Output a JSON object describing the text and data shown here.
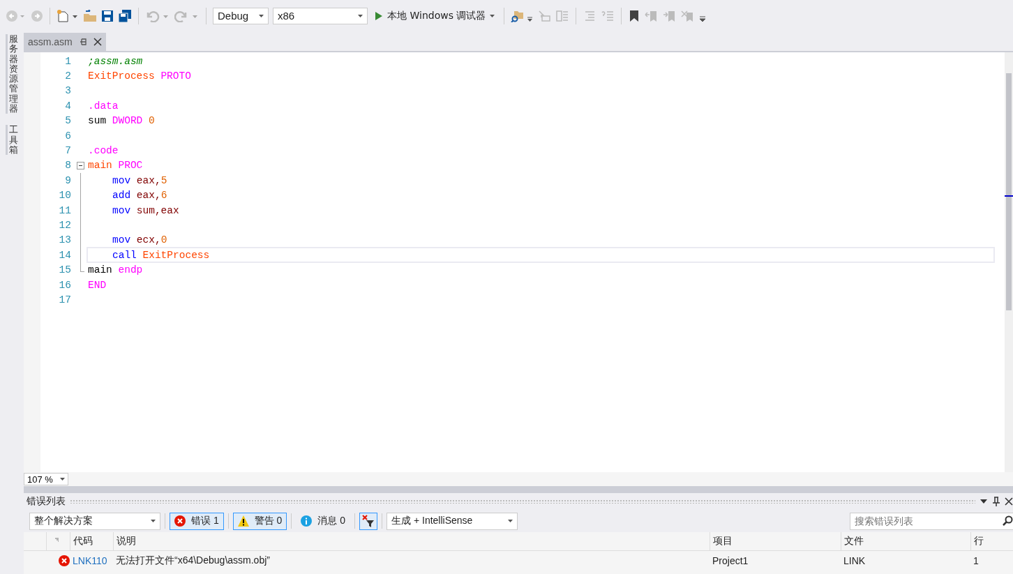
{
  "toolbar": {
    "configuration": "Debug",
    "platform": "x86",
    "run_label": "本地 Windows 调试器"
  },
  "side_tabs": [
    "服务器资源管理器",
    "工具箱"
  ],
  "document_tabs": [
    {
      "label": "assm.asm",
      "selected": true
    }
  ],
  "editor": {
    "lines": [
      {
        "number": "1",
        "tokens": [
          {
            "text": ";assm.asm",
            "kind": "comment"
          }
        ]
      },
      {
        "number": "2",
        "tokens": [
          {
            "text": "ExitProcess ",
            "kind": "proc"
          },
          {
            "text": "PROTO",
            "kind": "directive"
          }
        ]
      },
      {
        "number": "3"
      },
      {
        "number": "4",
        "tokens": [
          {
            "text": ".data",
            "kind": "directive"
          }
        ]
      },
      {
        "number": "5",
        "tokens": [
          {
            "text": "sum ",
            "kind": "plain"
          },
          {
            "text": "DWORD ",
            "kind": "directive"
          },
          {
            "text": "0",
            "kind": "number"
          }
        ]
      },
      {
        "number": "6"
      },
      {
        "number": "7",
        "tokens": [
          {
            "text": ".code",
            "kind": "directive"
          }
        ]
      },
      {
        "number": "8",
        "expanded": true,
        "tokens": [
          {
            "text": "main ",
            "kind": "proc"
          },
          {
            "text": "PROC",
            "kind": "directive"
          }
        ],
        "children": [
          {
            "number": "9",
            "indent": true,
            "tokens": [
              {
                "text": "mov ",
                "kind": "instr"
              },
              {
                "text": "eax,",
                "kind": "register"
              },
              {
                "text": "5",
                "kind": "number"
              }
            ]
          },
          {
            "number": "10",
            "indent": true,
            "tokens": [
              {
                "text": "add ",
                "kind": "instr"
              },
              {
                "text": "eax,",
                "kind": "register"
              },
              {
                "text": "6",
                "kind": "number"
              }
            ]
          },
          {
            "number": "11",
            "indent": true,
            "tokens": [
              {
                "text": "mov ",
                "kind": "instr"
              },
              {
                "text": "sum,eax",
                "kind": "register"
              }
            ]
          },
          {
            "number": "12"
          },
          {
            "number": "13",
            "indent": true,
            "tokens": [
              {
                "text": "mov ",
                "kind": "instr"
              },
              {
                "text": "ecx,",
                "kind": "register"
              },
              {
                "text": "0",
                "kind": "number"
              }
            ]
          },
          {
            "number": "14",
            "indent": true,
            "current": true,
            "tokens": [
              {
                "text": "call ",
                "kind": "instr"
              },
              {
                "text": "ExitProcess",
                "kind": "proc"
              }
            ]
          },
          {
            "number": "15",
            "tokens": [
              {
                "text": "main ",
                "kind": "plain"
              },
              {
                "text": "endp",
                "kind": "directive"
              }
            ]
          }
        ]
      },
      {
        "number": "16",
        "tokens": [
          {
            "text": "END",
            "kind": "directive"
          }
        ]
      },
      {
        "number": "17"
      }
    ],
    "zoom": "107 %"
  },
  "error_list": {
    "title": "错误列表",
    "scope": "整个解决方案",
    "filters": [
      {
        "kind": "error",
        "label": "错误 1",
        "selected": true
      },
      {
        "kind": "warning",
        "label": "警告 0",
        "selected": true
      },
      {
        "kind": "info",
        "label": "消息 0",
        "selected": false
      }
    ],
    "source": "生成 + IntelliSense",
    "search": {
      "placeholder": "搜索错误列表"
    },
    "columns": [
      "代码",
      "说明",
      "项目",
      "文件",
      "行"
    ],
    "rows": [
      {
        "kind": "error",
        "code": "LNK110",
        "description": "无法打开文件“x64\\Debug\\assm.obj”",
        "project": "Project1",
        "file": "LINK",
        "line": "1"
      }
    ]
  }
}
